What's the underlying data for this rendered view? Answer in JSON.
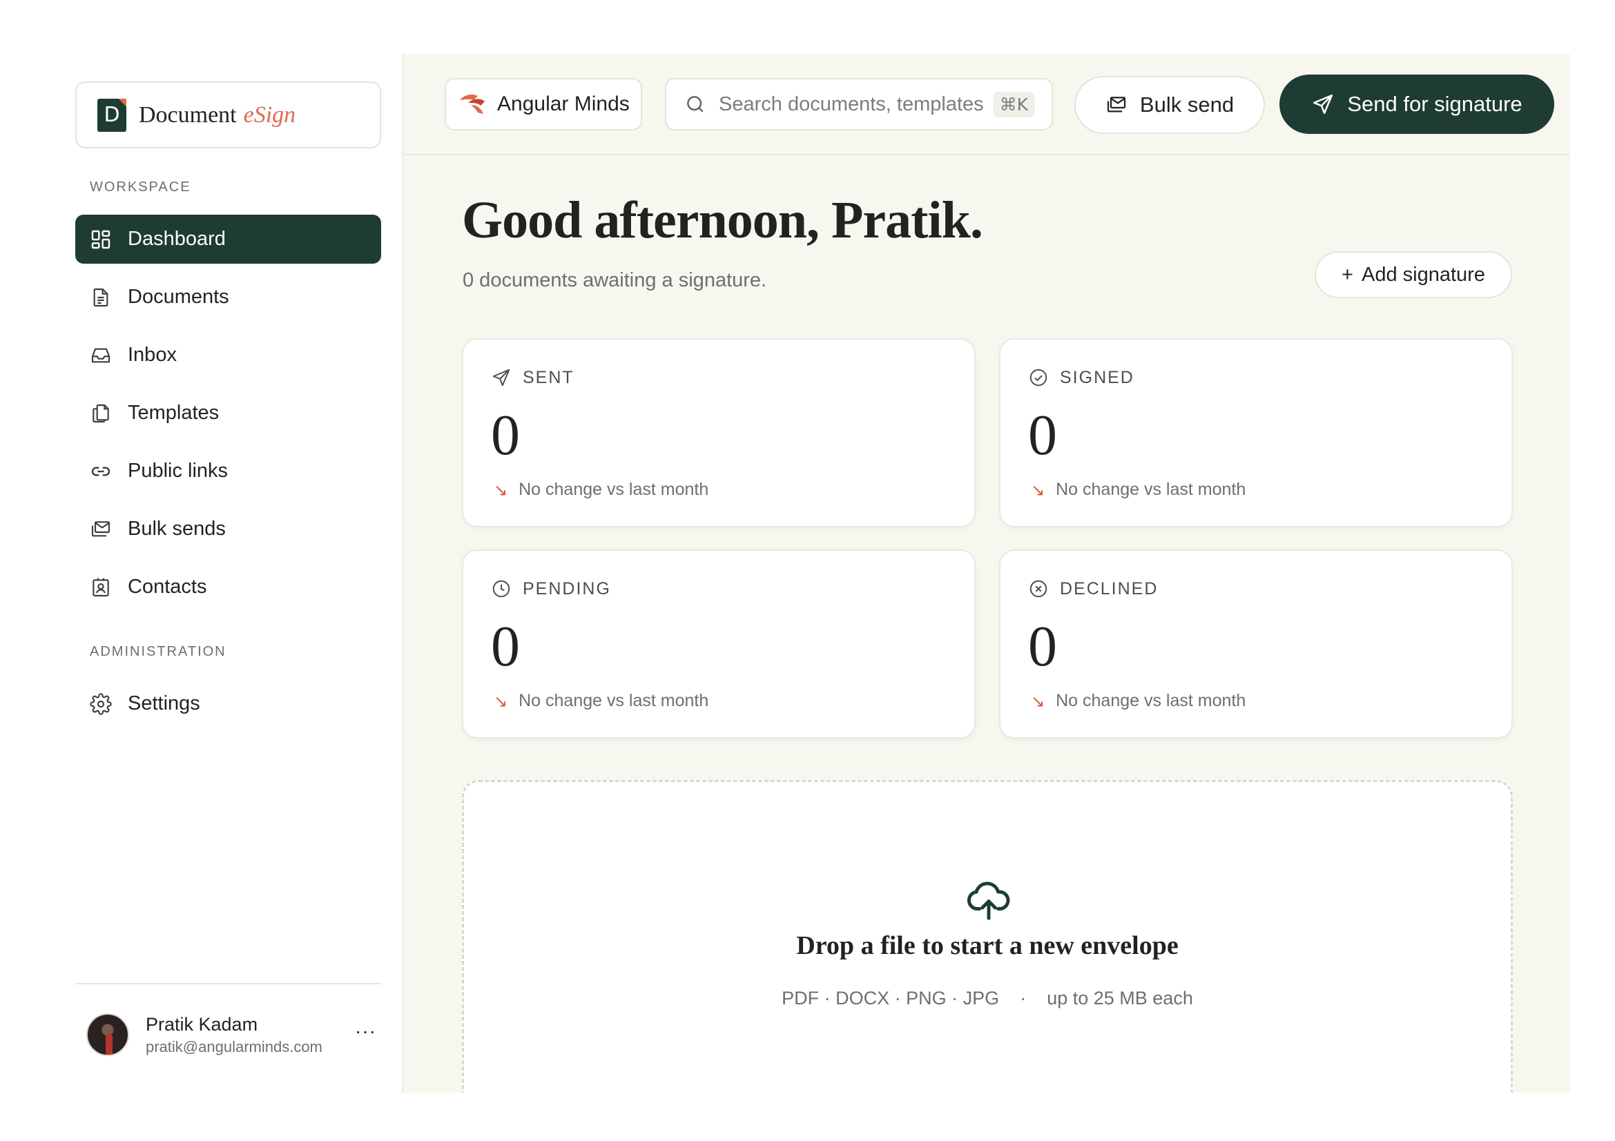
{
  "brand": {
    "name": "Document",
    "accent": "eSign",
    "mark": "D"
  },
  "sidebar": {
    "workspace_label": "WORKSPACE",
    "admin_label": "ADMINISTRATION",
    "items": [
      {
        "label": "Dashboard",
        "icon": "dashboard-icon",
        "active": true
      },
      {
        "label": "Documents",
        "icon": "document-icon"
      },
      {
        "label": "Inbox",
        "icon": "inbox-icon"
      },
      {
        "label": "Templates",
        "icon": "templates-icon"
      },
      {
        "label": "Public links",
        "icon": "link-icon"
      },
      {
        "label": "Bulk sends",
        "icon": "bulk-send-icon"
      },
      {
        "label": "Contacts",
        "icon": "contacts-icon"
      }
    ],
    "admin_items": [
      {
        "label": "Settings",
        "icon": "gear-icon"
      }
    ]
  },
  "user": {
    "name": "Pratik Kadam",
    "email": "pratik@angularminds.com",
    "more": "···"
  },
  "topbar": {
    "org_name": "Angular Minds",
    "search_placeholder": "Search documents, templates",
    "search_shortcut": "⌘K",
    "bulk_send_label": "Bulk send",
    "send_label": "Send for signature"
  },
  "main": {
    "greeting": "Good afternoon, Pratik.",
    "subline": "0 documents awaiting a signature.",
    "add_signature_label": "Add signature"
  },
  "stats": [
    {
      "label": "SENT",
      "value": "0",
      "change": "No change vs last month",
      "icon": "send-icon"
    },
    {
      "label": "SIGNED",
      "value": "0",
      "change": "No change vs last month",
      "icon": "check-circle-icon"
    },
    {
      "label": "PENDING",
      "value": "0",
      "change": "No change vs last month",
      "icon": "clock-icon"
    },
    {
      "label": "DECLINED",
      "value": "0",
      "change": "No change vs last month",
      "icon": "x-circle-icon"
    }
  ],
  "dropzone": {
    "title": "Drop a file to start a new envelope",
    "formats": "PDF · DOCX · PNG · JPG",
    "limit": "up to 25 MB each"
  },
  "colors": {
    "primary": "#1e3c33",
    "accent": "#e06a4c",
    "background": "#f8f7ef",
    "trend_arrow": "#d9583b"
  }
}
